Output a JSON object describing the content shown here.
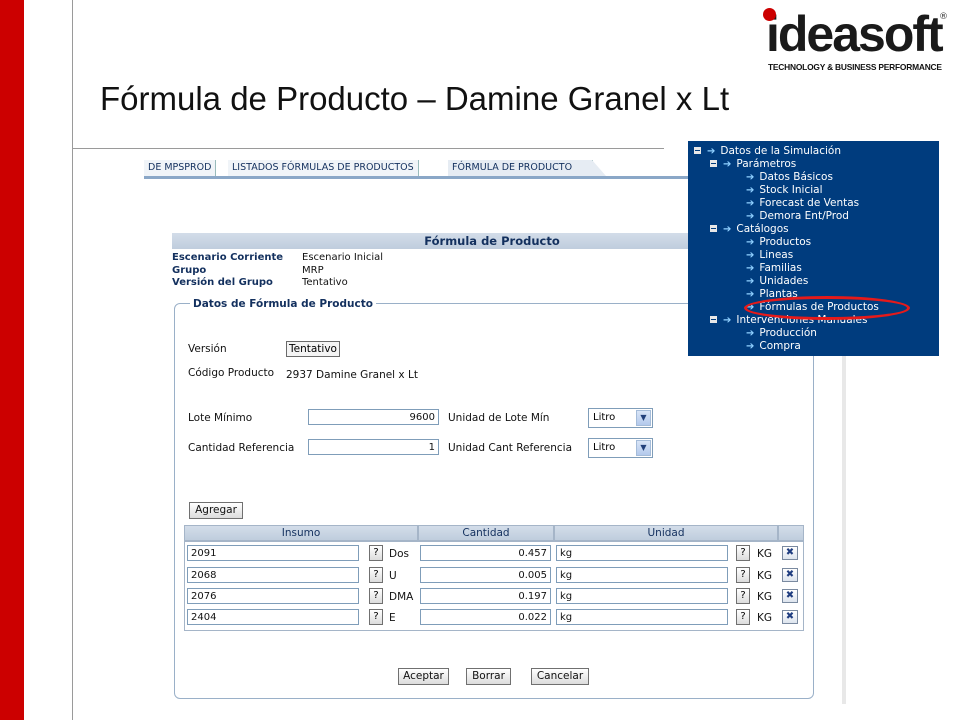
{
  "slide": {
    "title": "Fórmula de Producto – Damine Granel x Lt"
  },
  "logo": {
    "word": "ideasoft",
    "reg": "®",
    "tagline": "TECHNOLOGY & BUSINESS PERFORMANCE"
  },
  "tabs": [
    {
      "label": "DE MPSPROD",
      "active": false
    },
    {
      "label": "LISTADOS FÓRMULAS DE PRODUCTOS",
      "active": false
    },
    {
      "label": "FÓRMULA DE PRODUCTO",
      "active": true
    }
  ],
  "form": {
    "header": "Fórmula de Producto",
    "info": [
      {
        "key": "Escenario Corriente",
        "value": "Escenario Inicial"
      },
      {
        "key": "Grupo",
        "value": "MRP"
      },
      {
        "key": "Versión del Grupo",
        "value": "Tentativo"
      }
    ],
    "legend": "Datos de Fórmula de Producto",
    "version_label": "Versión",
    "version_value": "Tentativo",
    "product_label": "Código Producto",
    "product_value": "2937  Damine Granel x Lt",
    "lot_min_label": "Lote Mínimo",
    "lot_min_value": "9600",
    "lot_unit_label": "Unidad de Lote Mín",
    "lot_unit_value": "Litro",
    "ref_qty_label": "Cantidad Referencia",
    "ref_qty_value": "1",
    "ref_unit_label": "Unidad Cant Referencia",
    "ref_unit_value": "Litro",
    "add_button": "Agregar",
    "columns": [
      "Insumo",
      "Cantidad",
      "Unidad"
    ],
    "rows": [
      {
        "insumo": "2091",
        "code": "Dos",
        "cantidad": "0.457",
        "unidad": "kg",
        "ucode": "KG"
      },
      {
        "insumo": "2068",
        "code": "U",
        "cantidad": "0.005",
        "unidad": "kg",
        "ucode": "KG"
      },
      {
        "insumo": "2076",
        "code": "DMA",
        "cantidad": "0.197",
        "unidad": "kg",
        "ucode": "KG"
      },
      {
        "insumo": "2404",
        "code": "E",
        "cantidad": "0.022",
        "unidad": "kg",
        "ucode": "KG"
      }
    ],
    "lookup_glyph": "?",
    "delete_glyph": "✖",
    "buttons": {
      "accept": "Aceptar",
      "clear": "Borrar",
      "cancel": "Cancelar"
    }
  },
  "tree": {
    "root": "Datos de la Simulación",
    "groups": [
      {
        "label": "Parámetros",
        "items": [
          "Datos Básicos",
          "Stock Inicial",
          "Forecast de Ventas",
          "Demora Ent/Prod"
        ]
      },
      {
        "label": "Catálogos",
        "items": [
          "Productos",
          "Lineas",
          "Familias",
          "Unidades",
          "Plantas",
          "Fórmulas de Productos"
        ]
      },
      {
        "label": "Intervenciones Manuales",
        "items": [
          "Producción",
          "Compra"
        ]
      }
    ],
    "highlighted": "Fórmulas de Productos"
  },
  "colors": {
    "brand_red": "#cc0000",
    "tree_bg": "#003c7e",
    "header_text": "#13305e",
    "highlight": "#e51a1a"
  }
}
